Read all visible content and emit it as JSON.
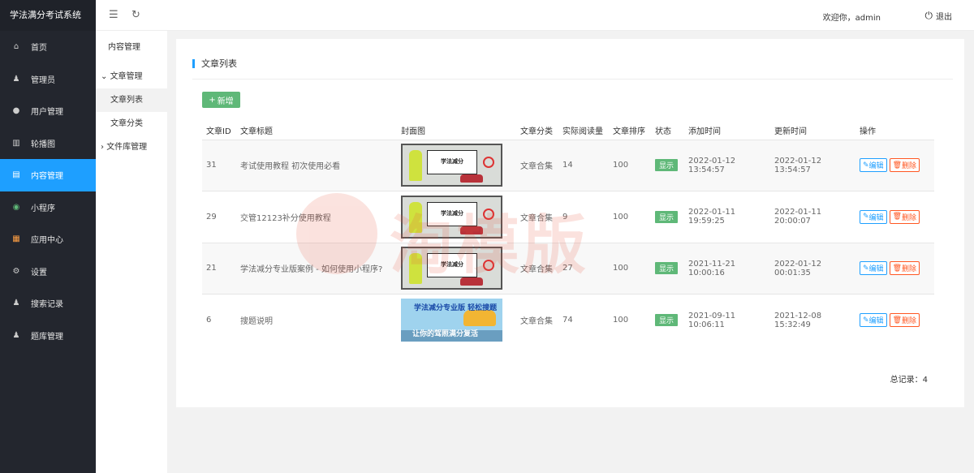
{
  "app": {
    "title": "学法满分考试系统"
  },
  "sidebar": {
    "items": [
      {
        "label": "首页",
        "icon": "home-icon"
      },
      {
        "label": "管理员",
        "icon": "user-admin-icon"
      },
      {
        "label": "用户管理",
        "icon": "user-icon"
      },
      {
        "label": "轮播图",
        "icon": "library-icon"
      },
      {
        "label": "内容管理",
        "icon": "document-icon"
      },
      {
        "label": "小程序",
        "icon": "miniprogram-icon"
      },
      {
        "label": "应用中心",
        "icon": "apps-icon"
      },
      {
        "label": "设置",
        "icon": "gear-icon"
      },
      {
        "label": "搜索记录",
        "icon": "user-search-icon"
      },
      {
        "label": "题库管理",
        "icon": "user-bank-icon"
      }
    ]
  },
  "topbar": {
    "welcome": "欢迎你，admin",
    "logout": "退出"
  },
  "subnav": {
    "title": "内容管理",
    "group1": "文章管理",
    "child1": "文章列表",
    "child2": "文章分类",
    "group2": "文件库管理"
  },
  "main": {
    "section_title": "文章列表",
    "add_label": "新增",
    "columns": [
      "文章ID",
      "文章标题",
      "封面图",
      "文章分类",
      "实际阅读量",
      "文章排序",
      "状态",
      "添加时间",
      "更新时间",
      "操作"
    ],
    "rows": [
      {
        "id": "31",
        "title": "考试使用教程 初次使用必看",
        "category": "文章合集",
        "reads": "14",
        "sort": "100",
        "status": "显示",
        "added": "2022-01-12 13:54:57",
        "updated": "2022-01-12 13:54:57"
      },
      {
        "id": "29",
        "title": "交管12123补分使用教程",
        "category": "文章合集",
        "reads": "9",
        "sort": "100",
        "status": "显示",
        "added": "2022-01-11 19:59:25",
        "updated": "2022-01-11 20:00:07"
      },
      {
        "id": "21",
        "title": "学法减分专业版案例 - 如何使用小程序?",
        "category": "文章合集",
        "reads": "27",
        "sort": "100",
        "status": "显示",
        "added": "2021-11-21 10:00:16",
        "updated": "2022-01-12 00:01:35"
      },
      {
        "id": "6",
        "title": "搜题说明",
        "category": "文章合集",
        "reads": "74",
        "sort": "100",
        "status": "显示",
        "added": "2021-09-11 10:06:11",
        "updated": "2021-12-08 15:32:49"
      }
    ],
    "edit_label": "编辑",
    "delete_label": "删除",
    "total": "总记录：4"
  },
  "covers": {
    "board_text": "学法减分",
    "banner_line1": "学法减分专业版 轻松搜题",
    "banner_line2": "让你的驾照满分复活"
  },
  "watermark": "淘模版",
  "colors": {
    "sidebar": "#23262e",
    "active": "#1e9fff",
    "green": "#5fb878",
    "danger": "#ff5722"
  }
}
